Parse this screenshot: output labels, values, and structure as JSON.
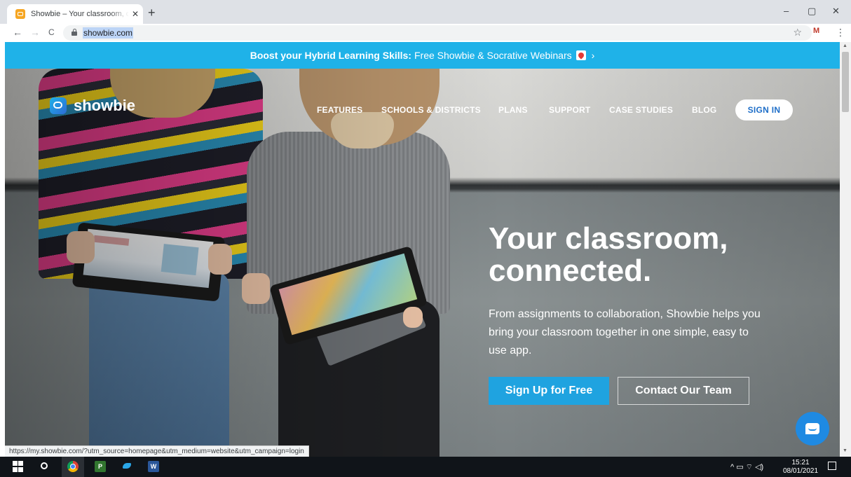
{
  "browser": {
    "tab_title": "Showbie – Your classroom, connected.",
    "close_glyph": "✕",
    "new_tab_glyph": "+",
    "url": "showbie.com",
    "nav_back": "←",
    "nav_forward": "→",
    "nav_reload": "C",
    "star_glyph": "☆",
    "ext_label": "M",
    "menu_glyph": "⋮",
    "window_minimize": "–",
    "window_restore": "▢",
    "window_close": "✕",
    "status_url": "https://my.showbie.com/?utm_source=homepage&utm_medium=website&utm_campaign=login"
  },
  "banner": {
    "bold": "Boost your Hybrid Learning Skills:",
    "text": "Free Showbie & Socrative Webinars",
    "chevron": "›"
  },
  "nav": {
    "logo": "showbie",
    "items": [
      "FEATURES",
      "SCHOOLS & DISTRICTS",
      "PLANS",
      "SUPPORT",
      "CASE STUDIES",
      "BLOG"
    ],
    "sign_in": "SIGN IN"
  },
  "hero": {
    "headline_1": "Your classroom,",
    "headline_2": "connected.",
    "subtext": "From assignments to collaboration, Showbie helps you bring your classroom together in one simple, easy to use app.",
    "cta_primary": "Sign Up for Free",
    "cta_secondary": "Contact Our Team"
  },
  "taskbar": {
    "project_label": "P",
    "word_label": "W",
    "tray_glyphs": "^ ▭ ⌔ ◁)",
    "time": "15:21",
    "date": "08/01/2021"
  },
  "colors": {
    "banner": "#1fb2e8",
    "primary_button": "#1fa3e0",
    "signin_text": "#1e6ec8",
    "chat": "#1f8ae2",
    "taskbar": "#101419"
  }
}
